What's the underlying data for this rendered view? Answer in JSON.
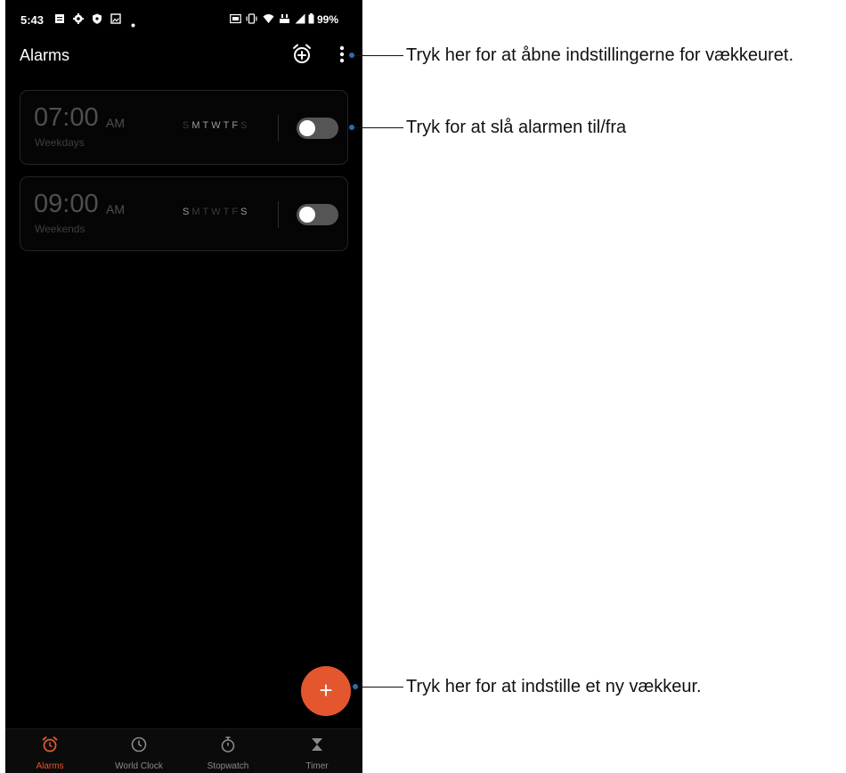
{
  "status_bar": {
    "time": "5:43",
    "battery": "99%"
  },
  "app_bar": {
    "title": "Alarms",
    "add_alarm_icon": "alarm-add-icon",
    "more_icon": "more-vert-icon"
  },
  "alarms": [
    {
      "time": "07:00",
      "ampm": "AM",
      "repeat": "Weekdays",
      "days": [
        "S",
        "M",
        "T",
        "W",
        "T",
        "F",
        "S"
      ],
      "days_active": [
        false,
        true,
        true,
        true,
        true,
        true,
        false
      ],
      "enabled": false
    },
    {
      "time": "09:00",
      "ampm": "AM",
      "repeat": "Weekends",
      "days": [
        "S",
        "M",
        "T",
        "W",
        "T",
        "F",
        "S"
      ],
      "days_active": [
        true,
        false,
        false,
        false,
        false,
        false,
        true
      ],
      "enabled": false
    }
  ],
  "fab": {
    "label": "+"
  },
  "bottom_nav": {
    "tabs": [
      {
        "label": "Alarms",
        "icon": "alarm-icon",
        "active": true
      },
      {
        "label": "World Clock",
        "icon": "clock-icon",
        "active": false
      },
      {
        "label": "Stopwatch",
        "icon": "stopwatch-icon",
        "active": false
      },
      {
        "label": "Timer",
        "icon": "hourglass-icon",
        "active": false
      }
    ]
  },
  "callouts": {
    "settings": "Tryk her for at åbne indstillingerne for vækkeuret.",
    "toggle": "Tryk for at slå alarmen til/fra",
    "add": "Tryk her for at indstille et ny vækkeur."
  },
  "colors": {
    "accent": "#e4572e",
    "callout_dot": "#2b6cb0",
    "background": "#000000"
  }
}
